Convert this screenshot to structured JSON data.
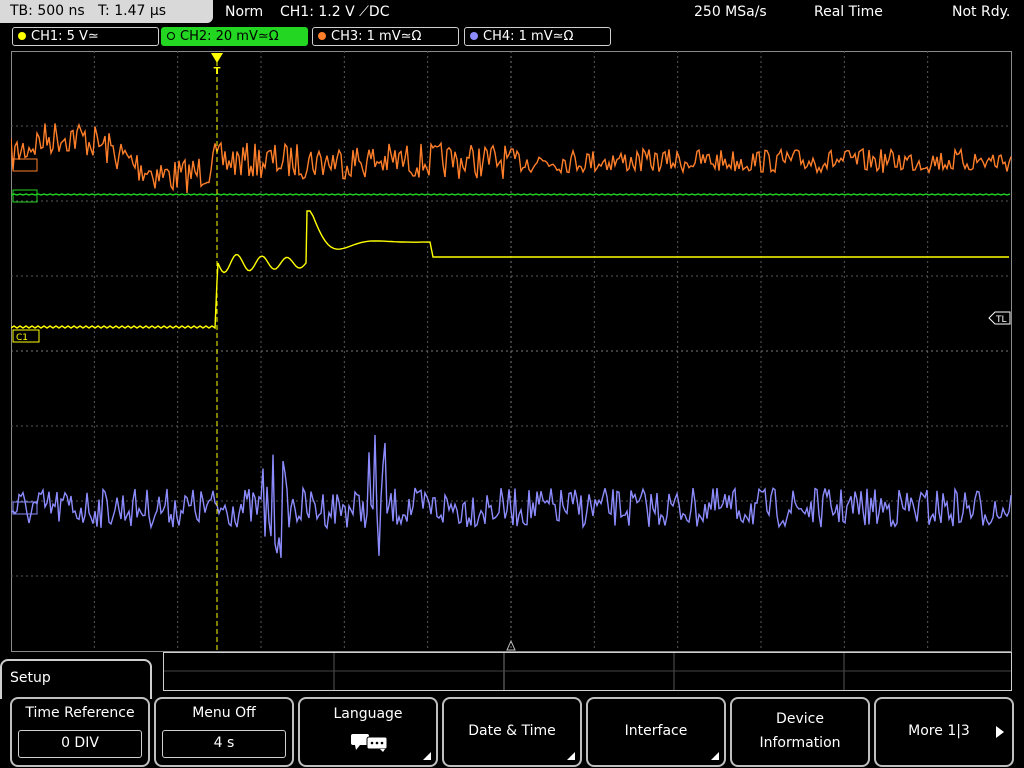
{
  "status": {
    "timebase": "TB: 500 ns",
    "time": "T: 1.47 µs",
    "trigger_mode": "Norm",
    "trigger_info": "CH1: 1.2 V ⟋DC",
    "sample_rate": "250 MSa/s",
    "acq_mode": "Real Time",
    "state": "Not Rdy."
  },
  "channels": [
    {
      "label": "CH1: 5 V≃",
      "color": "#ffff00"
    },
    {
      "label": "CH2: 20 mV≃Ω",
      "color": "#22d622"
    },
    {
      "label": "CH3: 1 mV≃Ω",
      "color": "#ff7f2a"
    },
    {
      "label": "CH4: 1 mV≃Ω",
      "color": "#8c8cff"
    }
  ],
  "markers": {
    "ch1": "C1",
    "trigger_level": "TL",
    "trigger_pos": "T"
  },
  "menu": {
    "title": "Setup",
    "softkeys": [
      {
        "label": "Time Reference",
        "value": "0 DIV"
      },
      {
        "label": "Menu Off",
        "value": "4 s"
      },
      {
        "label": "Language"
      },
      {
        "label": "Date & Time"
      },
      {
        "label": "Interface"
      },
      {
        "label": "Device",
        "label2": "Information"
      },
      {
        "label": "More 1|3"
      }
    ]
  },
  "colors": {
    "grid": "#595959",
    "ch1": "#ffff00",
    "ch2": "#22d622",
    "ch3": "#ff7f2a",
    "ch4": "#8c8cff"
  }
}
